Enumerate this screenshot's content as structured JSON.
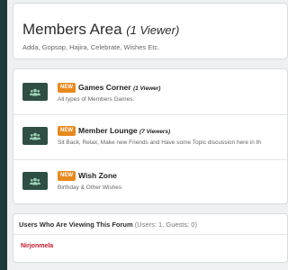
{
  "header": {
    "title": "Members Area",
    "viewer_count": "(1 Viewer)",
    "subtitle": "Adda, Gopsop, Hajira, Celebrate, Wishes Etc."
  },
  "forums": [
    {
      "badge": "NEW",
      "title": "Games Corner",
      "viewers": "(1 Viewer)",
      "description": "All types of Members Games.",
      "icon": "users-icon"
    },
    {
      "badge": "NEW",
      "title": "Member Lounge",
      "viewers": "(7 Viewers)",
      "description": "Sit Back, Relax, Make new Friends and Have some Topic discussion here in th",
      "icon": "users-icon"
    },
    {
      "badge": "NEW",
      "title": "Wish Zone",
      "viewers": "",
      "description": "Birthday & Other Wishes",
      "icon": "users-icon"
    }
  ],
  "who_viewing": {
    "label": "Users Who Are Viewing This Forum",
    "counts": "(Users: 1, Guests: 0)",
    "users": [
      "Nirjonmela"
    ]
  },
  "colors": {
    "badge": "#e8891d",
    "icon_bg": "#2f4f45",
    "username": "#c0182d",
    "page_bg": "#eef0f1"
  }
}
